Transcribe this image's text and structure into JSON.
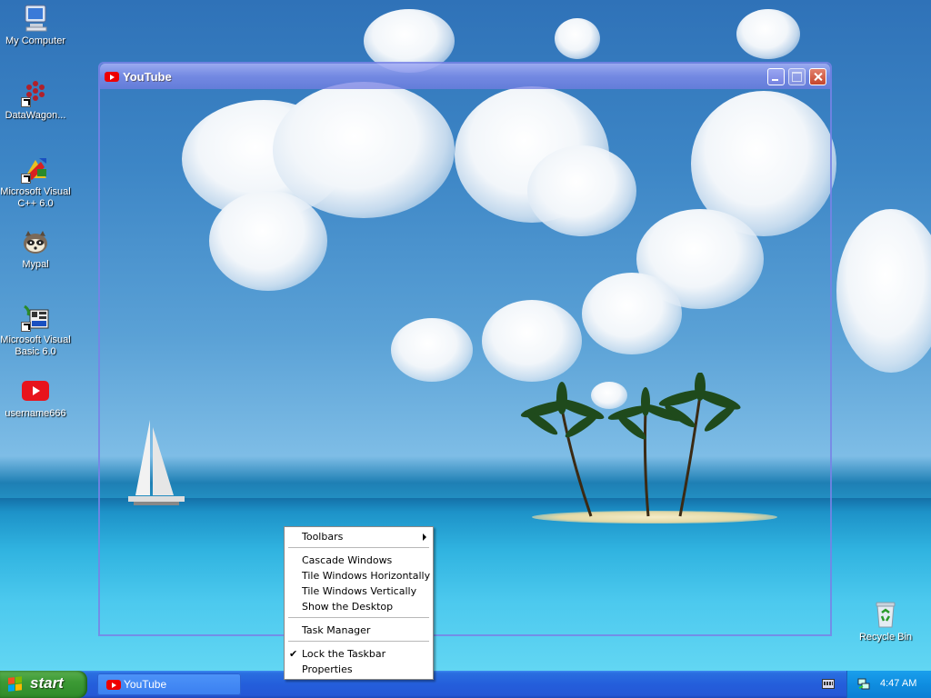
{
  "desktop": {
    "icons": [
      {
        "label": "My Computer"
      },
      {
        "label": "DataWagon..."
      },
      {
        "label": "Microsoft Visual C++ 6.0"
      },
      {
        "label": "Mypal"
      },
      {
        "label": "Microsoft Visual Basic 6.0"
      },
      {
        "label": "username666"
      },
      {
        "label": "Recycle Bin"
      }
    ]
  },
  "window": {
    "title": "YouTube",
    "buttons": {
      "minimize": "minimize-icon",
      "maximize": "maximize-icon",
      "close": "close-icon"
    }
  },
  "context_menu": {
    "items": [
      {
        "label": "Toolbars",
        "submenu": true
      },
      {
        "label": "Cascade Windows"
      },
      {
        "label": "Tile Windows Horizontally"
      },
      {
        "label": "Tile Windows Vertically"
      },
      {
        "label": "Show the Desktop"
      },
      {
        "label": "Task Manager"
      },
      {
        "label": "Lock the Taskbar",
        "checked": true
      },
      {
        "label": "Properties"
      }
    ]
  },
  "taskbar": {
    "start_label": "start",
    "tasks": [
      {
        "label": "YouTube",
        "icon": "youtube-icon"
      }
    ],
    "clock": "4:47 AM"
  },
  "colors": {
    "taskbar": "#245edb",
    "start_button": "#3c9a35",
    "tray": "#0f8de0",
    "window_frame": "#7f8ae6",
    "close_button": "#c5452c"
  }
}
